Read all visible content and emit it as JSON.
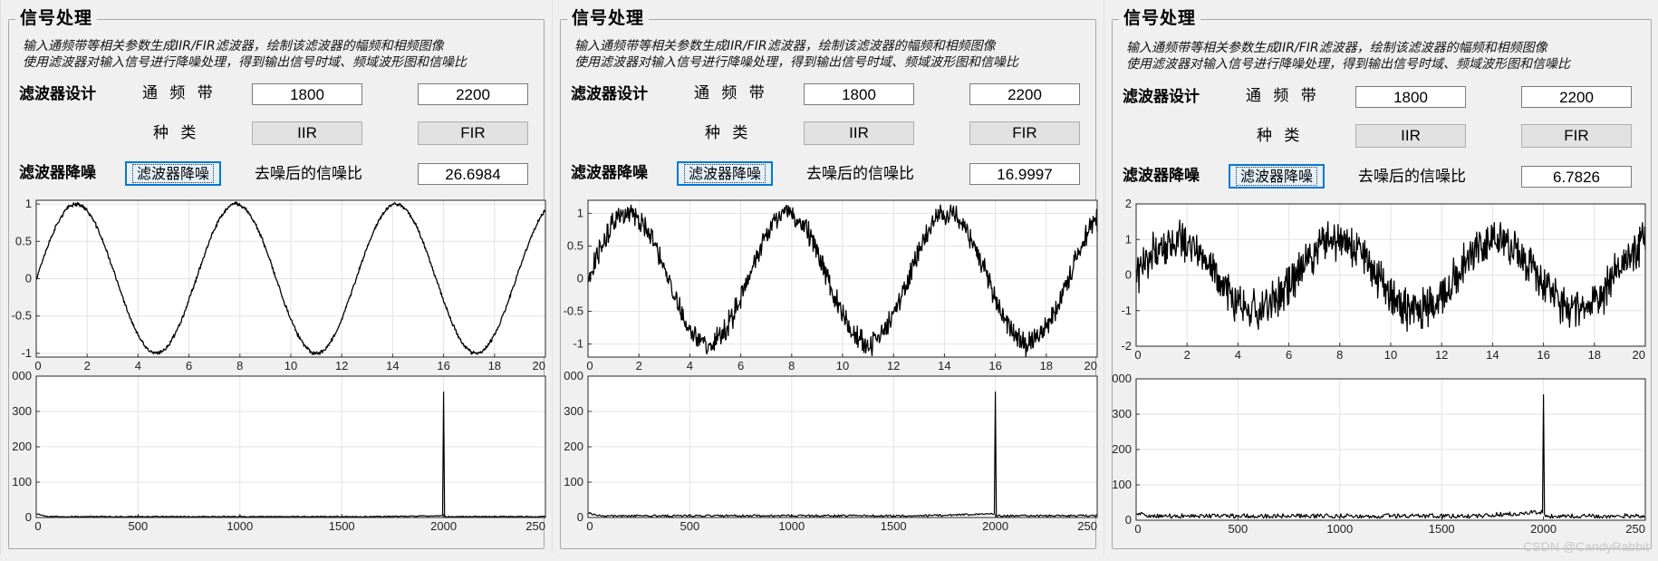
{
  "panels": [
    {
      "title": "信号处理",
      "description_line1": "输入通频带等相关参数生成IIR/FIR滤波器，绘制该滤波器的幅频和相频图像",
      "description_line2": "使用滤波器对输入信号进行降噪处理，得到输出信号时域、频域波形图和信噪比",
      "filter_design_label": "滤波器设计",
      "passband_label": "通 频 带",
      "passband_low": "1800",
      "passband_high": "2200",
      "type_label": "种 类",
      "iir_label": "IIR",
      "fir_label": "FIR",
      "denoise_label": "滤波器降噪",
      "denoise_button": "滤波器降噪",
      "snr_label": "去噪后的信噪比",
      "snr_value": "26.6984",
      "noise": 0.02,
      "time_axis": {
        "xlim": [
          0,
          20
        ],
        "ylim": [
          -1.05,
          1.05
        ],
        "xticks": [
          "0",
          "2",
          "4",
          "6",
          "8",
          "10",
          "12",
          "14",
          "16",
          "18",
          "20"
        ],
        "yticks": [
          {
            "v": 1,
            "t": "1"
          },
          {
            "v": 0.5,
            "t": "0.5"
          },
          {
            "v": 0,
            "t": "0"
          },
          {
            "v": -0.5,
            "t": "-0.5"
          },
          {
            "v": -1,
            "t": "-1"
          }
        ]
      },
      "freq_axis": {
        "xlim": [
          0,
          2500
        ],
        "ylim": [
          0,
          400
        ],
        "xticks": [
          "0",
          "500",
          "1000",
          "1500",
          "2000",
          "250"
        ],
        "yticks": [
          {
            "v": 400,
            "t": "000"
          },
          {
            "v": 300,
            "t": "300"
          },
          {
            "v": 200,
            "t": "200"
          },
          {
            "v": 100,
            "t": "100"
          },
          {
            "v": 0,
            "t": "0"
          }
        ],
        "peak_freq": 2000,
        "peak_value": 355,
        "floor": 3
      }
    },
    {
      "title": "信号处理",
      "description_line1": "输入通频带等相关参数生成IIR/FIR滤波器，绘制该滤波器的幅频和相频图像",
      "description_line2": "使用滤波器对输入信号进行降噪处理，得到输出信号时域、频域波形图和信噪比",
      "filter_design_label": "滤波器设计",
      "passband_label": "通 频 带",
      "passband_low": "1800",
      "passband_high": "2200",
      "type_label": "种 类",
      "iir_label": "IIR",
      "fir_label": "FIR",
      "denoise_label": "滤波器降噪",
      "denoise_button": "滤波器降噪",
      "snr_label": "去噪后的信噪比",
      "snr_value": "16.9997",
      "noise": 0.13,
      "time_axis": {
        "xlim": [
          0,
          20
        ],
        "ylim": [
          -1.2,
          1.2
        ],
        "xticks": [
          "0",
          "2",
          "4",
          "6",
          "8",
          "10",
          "12",
          "14",
          "16",
          "18",
          "20"
        ],
        "yticks": [
          {
            "v": 1,
            "t": "1"
          },
          {
            "v": 0.5,
            "t": "0.5"
          },
          {
            "v": 0,
            "t": "0"
          },
          {
            "v": -0.5,
            "t": "-0.5"
          },
          {
            "v": -1,
            "t": "-1"
          }
        ]
      },
      "freq_axis": {
        "xlim": [
          0,
          2500
        ],
        "ylim": [
          0,
          400
        ],
        "xticks": [
          "0",
          "500",
          "1000",
          "1500",
          "2000",
          "250"
        ],
        "yticks": [
          {
            "v": 400,
            "t": "000"
          },
          {
            "v": 300,
            "t": "300"
          },
          {
            "v": 200,
            "t": "200"
          },
          {
            "v": 100,
            "t": "100"
          },
          {
            "v": 0,
            "t": "0"
          }
        ],
        "peak_freq": 2000,
        "peak_value": 355,
        "floor": 6
      }
    },
    {
      "title": "信号处理",
      "description_line1": "输入通频带等相关参数生成IIR/FIR滤波器，绘制该滤波器的幅频和相频图像",
      "description_line2": "使用滤波器对输入信号进行降噪处理，得到输出信号时域、频域波形图和信噪比",
      "filter_design_label": "滤波器设计",
      "passband_label": "通 频 带",
      "passband_low": "1800",
      "passband_high": "2200",
      "type_label": "种 类",
      "iir_label": "IIR",
      "fir_label": "FIR",
      "denoise_label": "滤波器降噪",
      "denoise_button": "滤波器降噪",
      "snr_label": "去噪后的信噪比",
      "snr_value": "6.7826",
      "noise": 0.42,
      "time_axis": {
        "xlim": [
          0,
          20
        ],
        "ylim": [
          -2,
          2
        ],
        "xticks": [
          "0",
          "2",
          "4",
          "6",
          "8",
          "10",
          "12",
          "14",
          "16",
          "18",
          "20"
        ],
        "yticks": [
          {
            "v": 2,
            "t": "2"
          },
          {
            "v": 1,
            "t": "1"
          },
          {
            "v": 0,
            "t": "0"
          },
          {
            "v": -1,
            "t": "-1"
          },
          {
            "v": -2,
            "t": "-2"
          }
        ]
      },
      "freq_axis": {
        "xlim": [
          0,
          2500
        ],
        "ylim": [
          0,
          400
        ],
        "xticks": [
          "0",
          "500",
          "1000",
          "1500",
          "2000",
          "250"
        ],
        "yticks": [
          {
            "v": 400,
            "t": "000"
          },
          {
            "v": 300,
            "t": "300"
          },
          {
            "v": 200,
            "t": "200"
          },
          {
            "v": 100,
            "t": "100"
          },
          {
            "v": 0,
            "t": "0"
          }
        ],
        "peak_freq": 2000,
        "peak_value": 355,
        "floor": 14
      }
    }
  ],
  "watermark": "CSDN @CandyRabbit"
}
